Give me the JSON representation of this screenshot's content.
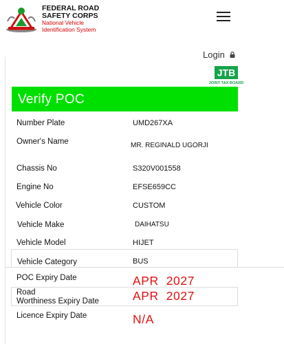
{
  "header": {
    "org_line1": "FEDERAL ROAD",
    "org_line2": "SAFETY CORPS",
    "sub_line1": "National Vehicle",
    "sub_line2": "Identification System",
    "menu_icon": "hamburger-menu-icon"
  },
  "login": {
    "label": "Login",
    "icon": "lock-icon"
  },
  "jtb": {
    "text": "JTB",
    "caption": "JOINT TAX BOARD"
  },
  "title": "Verify POC",
  "fields": {
    "number_plate": {
      "label": "Number Plate",
      "value": "UMD267XA"
    },
    "owner_name": {
      "label": "Owner's Name",
      "value": "MR. REGINALD UGORJI"
    },
    "chassis_no": {
      "label": "Chassis No",
      "value": "S320V001558"
    },
    "engine_no": {
      "label": "Engine No",
      "value": "EFSE659CC"
    },
    "vehicle_color": {
      "label": "Vehicle Color",
      "value": "CUSTOM"
    },
    "vehicle_make": {
      "label": "Vehicle Make",
      "value": "DAIHATSU"
    },
    "vehicle_model": {
      "label": "Vehicle Model",
      "value": "HIJET"
    },
    "vehicle_category": {
      "label": "Vehicle Category",
      "value": "BUS"
    },
    "poc_expiry": {
      "label": "POC Expiry Date",
      "value": "APR  2027"
    },
    "road_worthiness": {
      "label_line1": "Road",
      "label_line2": "Worthiness Expiry Date",
      "value": "APR  2027"
    },
    "licence_expiry": {
      "label": "Licence Expiry Date",
      "value": "N/A"
    }
  },
  "colors": {
    "banner_green": "#00e000",
    "date_red": "#e01010",
    "org_red": "#d40000"
  }
}
